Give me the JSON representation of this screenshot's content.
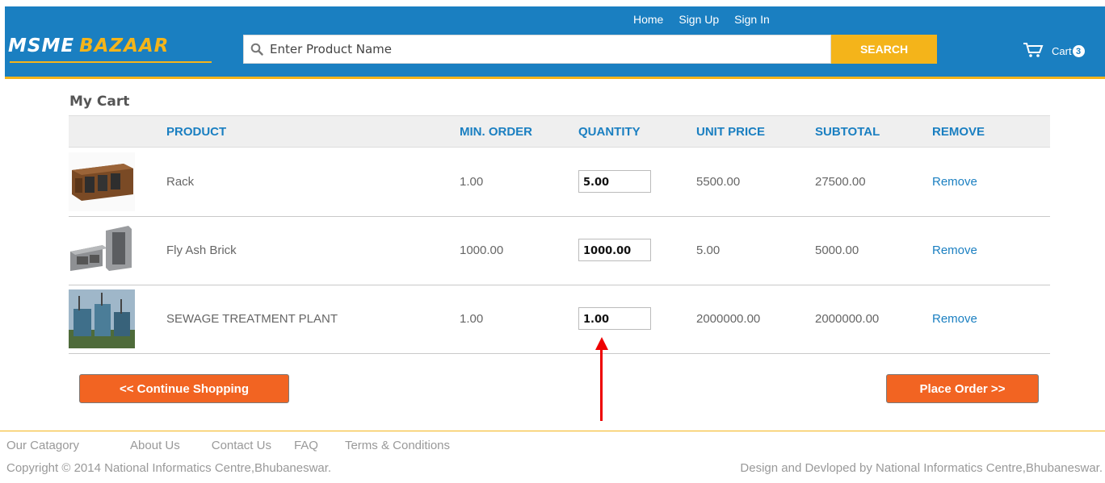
{
  "header": {
    "nav": [
      "Home",
      "Sign Up",
      "Sign In"
    ],
    "logo_part1": "MSME",
    "logo_part2": "BAZAAR",
    "search_placeholder": "Enter Product Name",
    "search_button": "SEARCH",
    "cart_label": "Cart",
    "cart_count": "3",
    "colors": {
      "primary": "#1a7fc1",
      "accent": "#f4b41a",
      "button": "#f26422"
    }
  },
  "cart": {
    "title": "My Cart",
    "columns": [
      "PRODUCT",
      "MIN. ORDER",
      "QUANTITY",
      "UNIT PRICE",
      "SUBTOTAL",
      "REMOVE"
    ],
    "items": [
      {
        "product": "Rack",
        "min_order": "1.00",
        "quantity": "5.00",
        "unit_price": "5500.00",
        "subtotal": "27500.00",
        "remove": "Remove"
      },
      {
        "product": "Fly Ash Brick",
        "min_order": "1000.00",
        "quantity": "1000.00",
        "unit_price": "5.00",
        "subtotal": "5000.00",
        "remove": "Remove"
      },
      {
        "product": "SEWAGE TREATMENT PLANT",
        "min_order": "1.00",
        "quantity": "1.00",
        "unit_price": "2000000.00",
        "subtotal": "2000000.00",
        "remove": "Remove"
      }
    ],
    "continue_button": "<<  Continue Shopping",
    "place_order_button": "Place Order  >>"
  },
  "footer": {
    "links": [
      "Our Catagory",
      "About Us",
      "Contact Us",
      "FAQ",
      "Terms & Conditions"
    ],
    "copyright": "Copyright © 2014 National Informatics Centre,Bhubaneswar.",
    "credit": "Design and Devloped by National Informatics Centre,Bhubaneswar."
  }
}
